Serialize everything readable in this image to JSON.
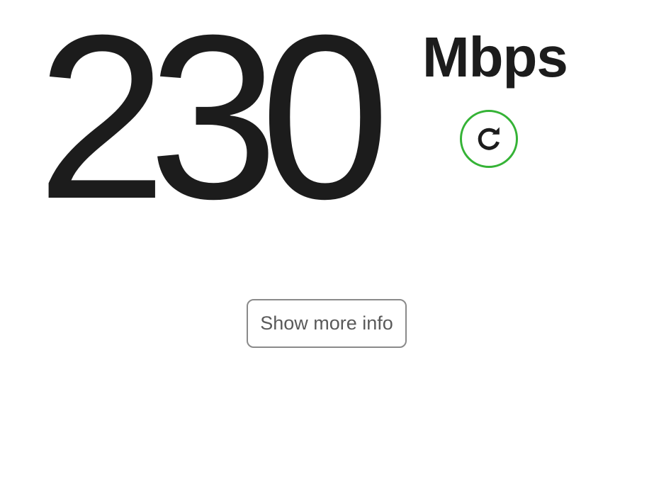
{
  "speed": {
    "value": "230",
    "units": "Mbps"
  },
  "actions": {
    "refresh_icon": "refresh-icon",
    "more_info_label": "Show more info"
  },
  "colors": {
    "text": "#1c1c1c",
    "refresh_ring": "#35b336",
    "button_border": "#8a8a8a",
    "button_text": "#5a5a5a",
    "background": "#ffffff"
  }
}
